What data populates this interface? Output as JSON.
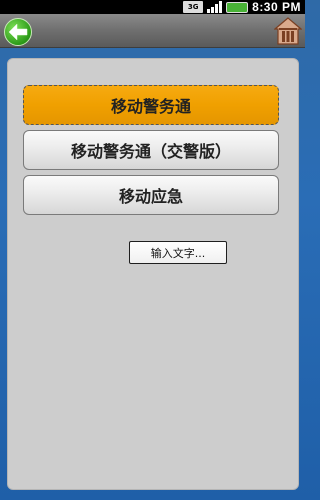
{
  "status_bar": {
    "network_label": "3G",
    "time": "8:30 PM"
  },
  "title_bar": {
    "back_icon": "back-arrow-icon",
    "home_icon": "home-icon"
  },
  "menu": {
    "items": [
      {
        "label": "移动警务通",
        "selected": true
      },
      {
        "label": "移动警务通（交警版）",
        "selected": false
      },
      {
        "label": "移动应急",
        "selected": false
      }
    ]
  },
  "input_button": {
    "label": "输入文字..."
  },
  "colors": {
    "selected_item": "#f0a000",
    "background_blue": "#2a6db6",
    "panel_gray": "#cdcdcd"
  }
}
